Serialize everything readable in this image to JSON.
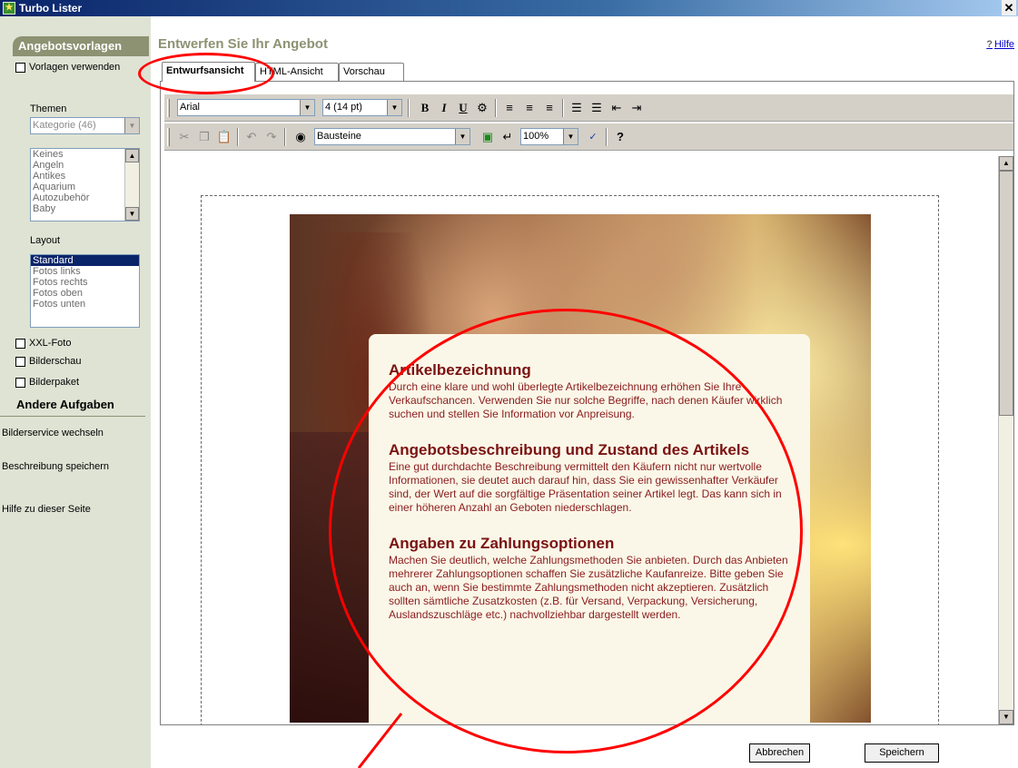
{
  "window": {
    "title": "Turbo Lister",
    "close_icon": "close-icon"
  },
  "left_panel": {
    "header": "Angebotsvorlagen",
    "use_templates_label": "Vorlagen verwenden",
    "themes_label": "Themen",
    "category_combo": "Kategorie (46)",
    "themes_list": [
      "Keines",
      "Angeln",
      "Antikes",
      "Aquarium",
      "Autozubehör",
      "Baby"
    ],
    "layout_label": "Layout",
    "layout_list": [
      "Standard",
      "Fotos links",
      "Fotos rechts",
      "Fotos oben",
      "Fotos unten"
    ],
    "layout_selected": "Standard",
    "xxl_foto": "XXL-Foto",
    "bilderschau": "Bilderschau",
    "bilderpaket": "Bilderpaket",
    "other_tasks_title": "Andere Aufgaben",
    "tasks": [
      "Bilderservice wechseln",
      "Beschreibung speichern",
      "Hilfe zu dieser Seite"
    ]
  },
  "main": {
    "title": "Entwerfen Sie Ihr Angebot",
    "help": "Hilfe",
    "tabs": [
      "Entwurfsansicht",
      "HTML-Ansicht",
      "Vorschau"
    ],
    "active_tab": "Entwurfsansicht"
  },
  "toolbar1": {
    "font": "Arial",
    "size": "4 (14 pt)",
    "bold": "B",
    "italic": "I",
    "underline": "U"
  },
  "toolbar2": {
    "insert_combo": "Bausteine",
    "zoom": "100%",
    "help": "?"
  },
  "content": {
    "sections": [
      {
        "heading": "Artikelbezeichnung",
        "text": "Durch eine klare und wohl überlegte Artikelbezeichnung erhöhen Sie Ihre Verkaufschancen. Verwenden Sie nur solche Begriffe, nach denen Käufer wirklich suchen und stellen Sie Information vor Anpreisung."
      },
      {
        "heading": "Angebotsbeschreibung und Zustand des Artikels",
        "text": "Eine gut durchdachte Beschreibung vermittelt den Käufern nicht nur wertvolle Informationen, sie deutet auch darauf hin, dass Sie ein gewissenhafter Verkäufer sind, der Wert auf die sorgfältige Präsentation seiner Artikel legt. Das kann sich in einer höheren Anzahl an Geboten niederschlagen."
      },
      {
        "heading": "Angaben zu Zahlungsoptionen",
        "text": "Machen Sie deutlich, welche Zahlungsmethoden Sie anbieten. Durch das Anbieten mehrerer Zahlungsoptionen schaffen Sie zusätzliche Kaufanreize. Bitte geben Sie auch an, wenn Sie bestimmte Zahlungsmethoden nicht akzeptieren. Zusätzlich sollten sämtliche Zusatzkosten (z.B. für Versand, Verpackung, Versicherung, Auslandszuschläge etc.) nachvollziehbar dargestellt werden."
      }
    ]
  },
  "buttons": {
    "cancel": "Abbrechen",
    "save": "Speichern"
  },
  "colors": {
    "annotation": "#ff0000",
    "panel_header": "#8c9272",
    "card_text": "#7a1212"
  }
}
